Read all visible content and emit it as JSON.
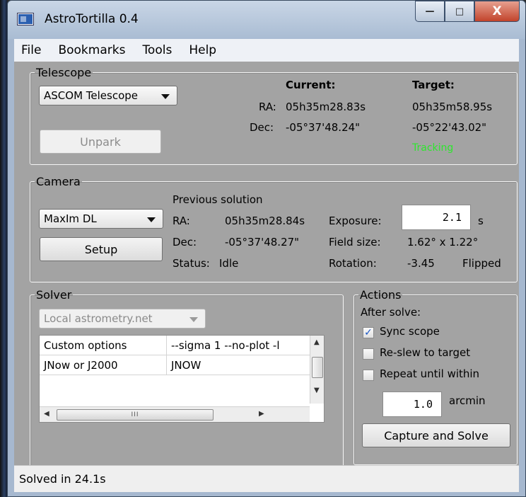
{
  "window": {
    "title": "AstroTortilla 0.4",
    "controls": {
      "minimize": "—",
      "maximize": "□",
      "close": "X"
    }
  },
  "menu": [
    "File",
    "Bookmarks",
    "Tools",
    "Help"
  ],
  "telescope": {
    "legend": "Telescope",
    "driver": "ASCOM Telescope",
    "unpark_label": "Unpark",
    "current_header": "Current:",
    "target_header": "Target:",
    "ra_label": "RA:",
    "dec_label": "Dec:",
    "current_ra": "05h35m28.83s",
    "current_dec": "-05°37'48.24\"",
    "target_ra": "05h35m58.95s",
    "target_dec": "-05°22'43.02\"",
    "tracking_status": "Tracking",
    "tracking_color": "#2ee62e"
  },
  "camera": {
    "legend": "Camera",
    "driver": "MaxIm DL",
    "setup_label": "Setup",
    "previous_solution_label": "Previous solution",
    "ra_label": "RA:",
    "dec_label": "Dec:",
    "status_label": "Status:",
    "ra": "05h35m28.84s",
    "dec": "-05°37'48.27\"",
    "status": "Idle",
    "exposure_label": "Exposure:",
    "exposure_value": "2.1",
    "exposure_unit": "s",
    "field_size_label": "Field size:",
    "field_size": "1.62° x 1.22°",
    "rotation_label": "Rotation:",
    "rotation": "-3.45",
    "flipped": "Flipped"
  },
  "solver": {
    "legend": "Solver",
    "engine": "Local astrometry.net",
    "grid_rows": [
      {
        "key": "Custom options",
        "value": "--sigma 1 --no-plot -l"
      },
      {
        "key": "JNow or J2000",
        "value": "JNOW"
      }
    ],
    "hscroll_grip": "III"
  },
  "actions": {
    "legend": "Actions",
    "after_solve": "After solve:",
    "sync_scope": {
      "label": "Sync scope",
      "checked": true
    },
    "reslew": {
      "label": "Re-slew to target",
      "checked": false
    },
    "repeat": {
      "label": "Repeat until within",
      "checked": false
    },
    "threshold_value": "1.0",
    "threshold_unit": "arcmin",
    "capture_label": "Capture and Solve"
  },
  "status_bar": "Solved in 24.1s"
}
